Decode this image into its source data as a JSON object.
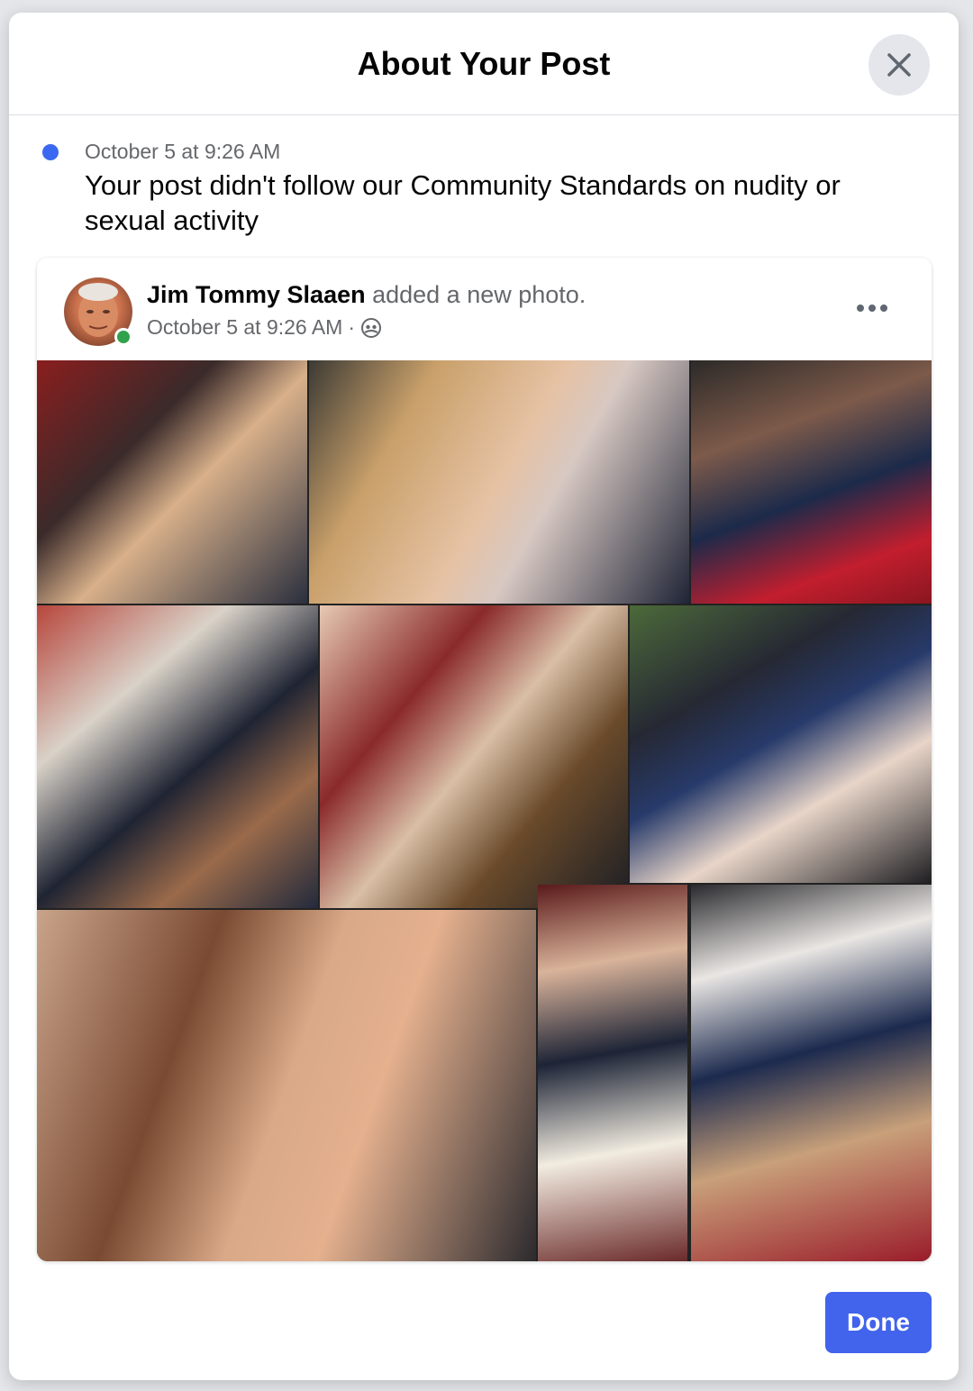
{
  "modal": {
    "title": "About Your Post",
    "close_icon": "close-icon"
  },
  "notice": {
    "time": "October 5 at 9:26 AM",
    "message": "Your post didn't follow our Community Standards on nudity or sexual activity",
    "status_color": "#3b68f0"
  },
  "post": {
    "author": "Jim Tommy Slaaen",
    "action": " added a new photo.",
    "time": "October 5 at 9:26 AM",
    "separator": "·",
    "audience_icon": "friends-icon",
    "more_icon": "more-options-icon",
    "online_color": "#31a24c",
    "photo_description": "Photo collage"
  },
  "footer": {
    "done_label": "Done",
    "accent_color": "#4263eb"
  }
}
